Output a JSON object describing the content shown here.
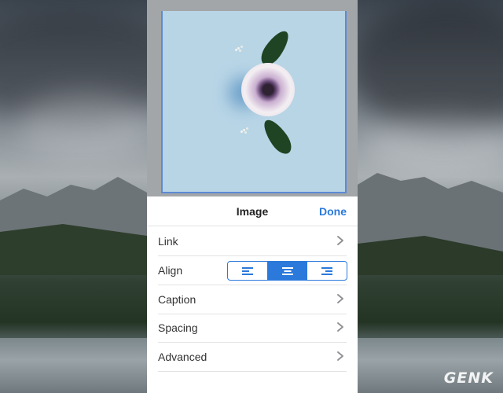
{
  "panel": {
    "title": "Image",
    "done_label": "Done"
  },
  "rows": {
    "link": "Link",
    "align": "Align",
    "caption": "Caption",
    "spacing": "Spacing",
    "advanced": "Advanced"
  },
  "align_options": [
    "left",
    "center",
    "right"
  ],
  "align_selected": "center",
  "watermark": "GENK",
  "colors": {
    "accent": "#2b79db",
    "photo_bg": "#b8d5e6"
  }
}
